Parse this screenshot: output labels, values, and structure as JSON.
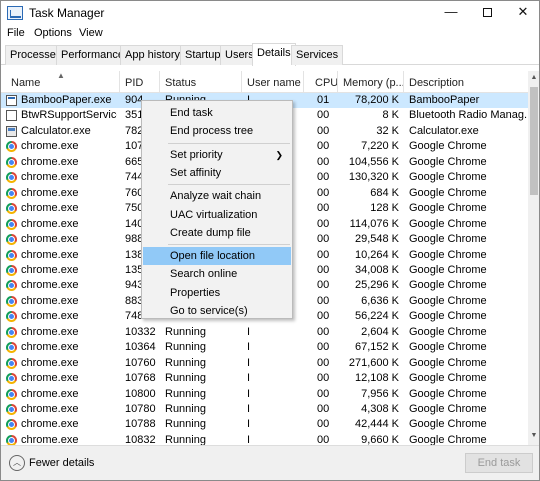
{
  "window": {
    "title": "Task Manager",
    "controls": {
      "minimize": "—",
      "close": "✕"
    }
  },
  "menubar": [
    "File",
    "Options",
    "View"
  ],
  "tabs": [
    "Processes",
    "Performance",
    "App history",
    "Startup",
    "Users",
    "Details",
    "Services"
  ],
  "active_tab": "Details",
  "columns": {
    "name": "Name",
    "pid": "PID",
    "status": "Status",
    "user": "User name",
    "cpu": "CPU",
    "memory": "Memory (p...",
    "description": "Description"
  },
  "rows": [
    {
      "name": "BambooPaper.exe",
      "pid": "904",
      "status": "Running",
      "user": "I",
      "cpu": "01",
      "memory": "78,200 K",
      "description": "BambooPaper",
      "icon": "app-icon",
      "selected": true
    },
    {
      "name": "BtwRSupportService.",
      "pid": "351",
      "status": "",
      "user": "",
      "cpu": "00",
      "memory": "8 K",
      "description": "Bluetooth Radio Manag...",
      "icon": "bluetooth-app-icon"
    },
    {
      "name": "Calculator.exe",
      "pid": "782",
      "status": "",
      "user": "",
      "cpu": "00",
      "memory": "32 K",
      "description": "Calculator.exe",
      "icon": "calculator-icon"
    },
    {
      "name": "chrome.exe",
      "pid": "107",
      "status": "",
      "user": "",
      "cpu": "00",
      "memory": "7,220 K",
      "description": "Google Chrome",
      "icon": "chrome-icon"
    },
    {
      "name": "chrome.exe",
      "pid": "665",
      "status": "",
      "user": "",
      "cpu": "00",
      "memory": "104,556 K",
      "description": "Google Chrome",
      "icon": "chrome-icon"
    },
    {
      "name": "chrome.exe",
      "pid": "744",
      "status": "",
      "user": "",
      "cpu": "00",
      "memory": "130,320 K",
      "description": "Google Chrome",
      "icon": "chrome-icon"
    },
    {
      "name": "chrome.exe",
      "pid": "760",
      "status": "",
      "user": "",
      "cpu": "00",
      "memory": "684 K",
      "description": "Google Chrome",
      "icon": "chrome-icon"
    },
    {
      "name": "chrome.exe",
      "pid": "750",
      "status": "",
      "user": "",
      "cpu": "00",
      "memory": "128 K",
      "description": "Google Chrome",
      "icon": "chrome-icon"
    },
    {
      "name": "chrome.exe",
      "pid": "140",
      "status": "",
      "user": "",
      "cpu": "00",
      "memory": "114,076 K",
      "description": "Google Chrome",
      "icon": "chrome-icon"
    },
    {
      "name": "chrome.exe",
      "pid": "988",
      "status": "",
      "user": "",
      "cpu": "00",
      "memory": "29,548 K",
      "description": "Google Chrome",
      "icon": "chrome-icon"
    },
    {
      "name": "chrome.exe",
      "pid": "138",
      "status": "",
      "user": "",
      "cpu": "00",
      "memory": "10,264 K",
      "description": "Google Chrome",
      "icon": "chrome-icon"
    },
    {
      "name": "chrome.exe",
      "pid": "135",
      "status": "",
      "user": "",
      "cpu": "00",
      "memory": "34,008 K",
      "description": "Google Chrome",
      "icon": "chrome-icon"
    },
    {
      "name": "chrome.exe",
      "pid": "943",
      "status": "",
      "user": "",
      "cpu": "00",
      "memory": "25,296 K",
      "description": "Google Chrome",
      "icon": "chrome-icon"
    },
    {
      "name": "chrome.exe",
      "pid": "883",
      "status": "",
      "user": "",
      "cpu": "00",
      "memory": "6,636 K",
      "description": "Google Chrome",
      "icon": "chrome-icon"
    },
    {
      "name": "chrome.exe",
      "pid": "748",
      "status": "",
      "user": "",
      "cpu": "00",
      "memory": "56,224 K",
      "description": "Google Chrome",
      "icon": "chrome-icon"
    },
    {
      "name": "chrome.exe",
      "pid": "10332",
      "status": "Running",
      "user": "I",
      "cpu": "00",
      "memory": "2,604 K",
      "description": "Google Chrome",
      "icon": "chrome-icon"
    },
    {
      "name": "chrome.exe",
      "pid": "10364",
      "status": "Running",
      "user": "I",
      "cpu": "00",
      "memory": "67,152 K",
      "description": "Google Chrome",
      "icon": "chrome-icon"
    },
    {
      "name": "chrome.exe",
      "pid": "10760",
      "status": "Running",
      "user": "I",
      "cpu": "00",
      "memory": "271,600 K",
      "description": "Google Chrome",
      "icon": "chrome-icon"
    },
    {
      "name": "chrome.exe",
      "pid": "10768",
      "status": "Running",
      "user": "I",
      "cpu": "00",
      "memory": "12,108 K",
      "description": "Google Chrome",
      "icon": "chrome-icon"
    },
    {
      "name": "chrome.exe",
      "pid": "10800",
      "status": "Running",
      "user": "I",
      "cpu": "00",
      "memory": "7,956 K",
      "description": "Google Chrome",
      "icon": "chrome-icon"
    },
    {
      "name": "chrome.exe",
      "pid": "10780",
      "status": "Running",
      "user": "I",
      "cpu": "00",
      "memory": "4,308 K",
      "description": "Google Chrome",
      "icon": "chrome-icon"
    },
    {
      "name": "chrome.exe",
      "pid": "10788",
      "status": "Running",
      "user": "I",
      "cpu": "00",
      "memory": "42,444 K",
      "description": "Google Chrome",
      "icon": "chrome-icon"
    },
    {
      "name": "chrome.exe",
      "pid": "10832",
      "status": "Running",
      "user": "I",
      "cpu": "00",
      "memory": "9,660 K",
      "description": "Google Chrome",
      "icon": "chrome-icon"
    }
  ],
  "context_menu": {
    "groups": [
      [
        {
          "label": "End task"
        },
        {
          "label": "End process tree"
        }
      ],
      [
        {
          "label": "Set priority",
          "submenu": true
        },
        {
          "label": "Set affinity"
        }
      ],
      [
        {
          "label": "Analyze wait chain"
        },
        {
          "label": "UAC virtualization"
        },
        {
          "label": "Create dump file"
        }
      ],
      [
        {
          "label": "Open file location",
          "highlighted": true
        },
        {
          "label": "Search online"
        },
        {
          "label": "Properties"
        },
        {
          "label": "Go to service(s)"
        }
      ]
    ]
  },
  "footer": {
    "fewer_details": "Fewer details",
    "end_task": "End task"
  },
  "colors": {
    "selection": "#cce8ff",
    "menu_highlight": "#91c9f7"
  }
}
